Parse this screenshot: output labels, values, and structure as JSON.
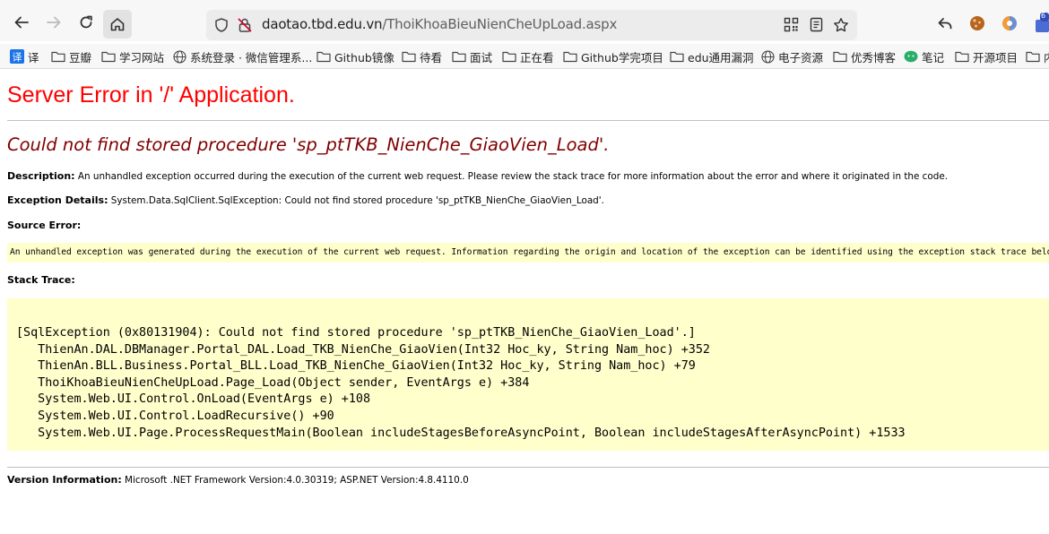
{
  "browser": {
    "url_host": "daotao.tbd.edu.vn",
    "url_path": "/ThoiKhoaBieuNienCheUpLoad.aspx",
    "extension_badge": "6"
  },
  "bookmarks": [
    {
      "label": "译",
      "icon": "translate-icon"
    },
    {
      "label": "豆瓣",
      "icon": "folder-icon"
    },
    {
      "label": "学习网站",
      "icon": "folder-icon"
    },
    {
      "label": "系统登录 · 微信管理系...",
      "icon": "globe-icon"
    },
    {
      "label": "Github镜像",
      "icon": "folder-icon"
    },
    {
      "label": "待看",
      "icon": "folder-icon"
    },
    {
      "label": "面试",
      "icon": "folder-icon"
    },
    {
      "label": "正在看",
      "icon": "folder-icon"
    },
    {
      "label": "Github学完项目",
      "icon": "folder-icon"
    },
    {
      "label": "edu通用漏洞",
      "icon": "folder-icon"
    },
    {
      "label": "电子资源",
      "icon": "globe-icon"
    },
    {
      "label": "优秀博客",
      "icon": "folder-icon"
    },
    {
      "label": "笔记",
      "icon": "wechat-icon"
    },
    {
      "label": "开源项目",
      "icon": "folder-icon"
    },
    {
      "label": "内",
      "icon": "folder-icon"
    }
  ],
  "page": {
    "title": "Server Error in '/' Application.",
    "error_heading": "Could not find stored procedure 'sp_ptTKB_NienChe_GiaoVien_Load'.",
    "description_label": "Description:",
    "description_text": "An unhandled exception occurred during the execution of the current web request. Please review the stack trace for more information about the error and where it originated in the code.",
    "exception_label": "Exception Details:",
    "exception_text": "System.Data.SqlClient.SqlException: Could not find stored procedure 'sp_ptTKB_NienChe_GiaoVien_Load'.",
    "source_error_label": "Source Error:",
    "source_error_text": "An unhandled exception was generated during the execution of the current web request. Information regarding the origin and location of the exception can be identified using the exception stack trace below.",
    "stack_trace_label": "Stack Trace:",
    "stack_trace": "[SqlException (0x80131904): Could not find stored procedure 'sp_ptTKB_NienChe_GiaoVien_Load'.]\n   ThienAn.DAL.DBManager.Portal_DAL.Load_TKB_NienChe_GiaoVien(Int32 Hoc_ky, String Nam_hoc) +352\n   ThienAn.BLL.Business.Portal_BLL.Load_TKB_NienChe_GiaoVien(Int32 Hoc_ky, String Nam_hoc) +79\n   ThoiKhoaBieuNienCheUpLoad.Page_Load(Object sender, EventArgs e) +384\n   System.Web.UI.Control.OnLoad(EventArgs e) +108\n   System.Web.UI.Control.LoadRecursive() +90\n   System.Web.UI.Page.ProcessRequestMain(Boolean includeStagesBeforeAsyncPoint, Boolean includeStagesAfterAsyncPoint) +1533",
    "version_label": "Version Information:",
    "version_text": "Microsoft .NET Framework Version:4.0.30319; ASP.NET Version:4.8.4110.0"
  },
  "colors": {
    "title": "#ff0000",
    "heading": "#800000",
    "code_background": "#ffffcc"
  }
}
